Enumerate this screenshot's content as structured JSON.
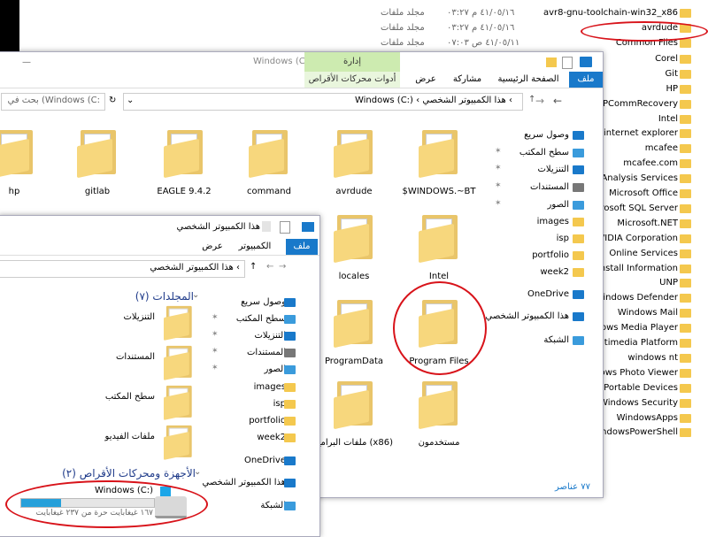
{
  "background_list": {
    "rows": [
      {
        "type": "مجلد ملفات",
        "date": "٤١/٠٥/١٦ م ٠٣:٢٧"
      },
      {
        "type": "مجلد ملفات",
        "date": "٤١/٠٥/١٦ م ٠٣:٢٧"
      },
      {
        "type": "مجلد ملفات",
        "date": "٤١/٠٥/١١ ص ٠٧:٠٣"
      }
    ],
    "names": [
      "avr8-gnu-toolchain-win32_x86",
      "avrdude",
      "Common Files",
      "Corel",
      "Git",
      "HP",
      "HPCommRecovery",
      "Intel",
      "internet explorer",
      "mcafee",
      "mcafee.com",
      "oft Analysis Services",
      "Microsoft Office",
      "icrosoft SQL Server",
      "Microsoft.NET",
      "NVIDIA Corporation",
      "Online Services",
      "ninstall Information",
      "UNP",
      "Windows Defender",
      "Windows Mail",
      "dows Media Player",
      "Multimedia Platform",
      "windows nt",
      "ndows Photo Viewer",
      "ws Portable Devices",
      "Windows Security",
      "WindowsApps",
      "WindowsPowerShell"
    ]
  },
  "main_window": {
    "title": "Windows (C:)",
    "manage_tab": "إدارة",
    "drive_tools": "أدوات محركات الأقراص",
    "tabs": [
      "ملف",
      "الصفحة الرئيسية",
      "مشاركة",
      "عرض"
    ],
    "address": "Windows (C:)  ‹  هذا الكمبيوتر الشخصي  ‹",
    "search_placeholder": "بحث في (Windows (C:",
    "nav": [
      "وصول سريع",
      "سطح المكتب",
      "التنزيلات",
      "المستندات",
      "الصور",
      "images",
      "isp",
      "portfolio",
      "week2",
      "OneDrive",
      "هذا الكمبيوتر الشخصي",
      "الشبكة"
    ],
    "folders_row1": [
      "$WINDOWS.~BT",
      "avrdude",
      "command",
      "EAGLE 9.4.2",
      "gitlab",
      "hp"
    ],
    "folders_col": [
      "Intel",
      "locales",
      "Program Files",
      "ProgramData",
      "مستخدمون",
      "ملفات البرامج (x86)"
    ],
    "status": "٧٧ عناصر"
  },
  "front_window": {
    "title": "هذا الكمبيوتر الشخصي",
    "tabs": [
      "ملف",
      "الكمبيوتر",
      "عرض"
    ],
    "address": "هذا الكمبيوتر الشخصي  ‹",
    "nav": [
      "وصول سريع",
      "سطح المكتب",
      "التنزيلات",
      "المستندات",
      "الصور",
      "images",
      "isp",
      "portfolio",
      "week2",
      "OneDrive",
      "هذا الكمبيوتر الشخصي",
      "الشبكة"
    ],
    "folders_header": "المجلدات (٧)",
    "folders": [
      "التنزيلات",
      "المستندات",
      "سطح المكتب",
      "ملفات الفيديو"
    ],
    "devices_header": "الأجهزة ومحركات الأقراص (٢)",
    "drive_name": "Windows (C:)",
    "drive_free": "١٦٧ غيغابايت حرة من ٢٣٧ غيغابايت",
    "drive_fill": 0.3
  },
  "colors": {
    "accent": "#1979ca",
    "annotation": "#d8131a",
    "folder": "#f4c84e"
  }
}
